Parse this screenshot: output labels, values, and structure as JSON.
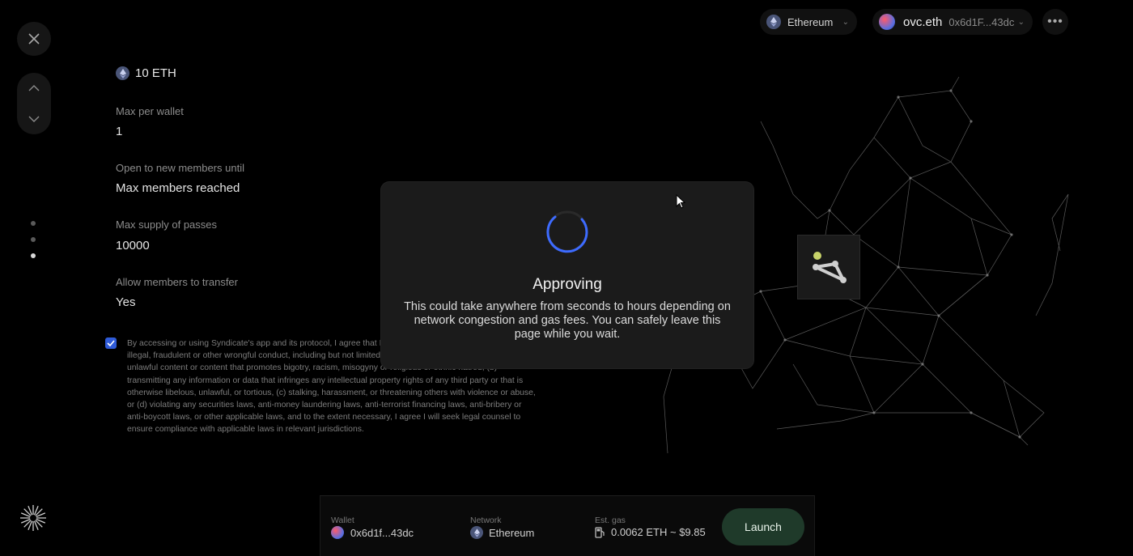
{
  "topbar": {
    "network_label": "Ethereum",
    "wallet_ens": "ovc.eth",
    "wallet_address": "0x6d1F...43dc",
    "more_icon": "more-horizontal-icon"
  },
  "rail": {
    "close_icon": "close-icon",
    "up_icon": "chevron-up-icon",
    "down_icon": "chevron-down-icon",
    "step_count": 3,
    "active_step": 3
  },
  "form": {
    "price": "10 ETH",
    "fields": [
      {
        "label": "Max per wallet",
        "value": "1"
      },
      {
        "label": "Open to new members until",
        "value": "Max members reached"
      },
      {
        "label": "Max supply of passes",
        "value": "10000"
      },
      {
        "label": "Allow members to transfer",
        "value": "Yes"
      }
    ],
    "terms_checked": true,
    "terms_text": "By accessing or using Syndicate's app and its protocol, I agree that I will not use the protocol to engage in illegal, fraudulent or other wrongful conduct, including but not limited to distributing defamatory, obscene or unlawful content or content that promotes bigotry, racism, misogyny or religious or ethnic hatred, (b) transmitting any information or data that infringes any intellectual property rights of any third party or that is otherwise libelous, unlawful, or tortious, (c) stalking, harassment, or threatening others with violence or abuse, or (d) violating any securities laws, anti-money laundering laws, anti-terrorist financing laws, anti-bribery or anti-boycott laws, or other applicable laws, and to the extent necessary, I agree I will seek legal counsel to ensure compliance with applicable laws in relevant jurisdictions."
  },
  "modal": {
    "title": "Approving",
    "body": "This could take anywhere from seconds to hours depending on network congestion and gas fees. You can safely leave this page while you wait."
  },
  "footer": {
    "wallet_label": "Wallet",
    "wallet_value": "0x6d1f...43dc",
    "network_label": "Network",
    "network_value": "Ethereum",
    "gas_label": "Est. gas",
    "gas_value": "0.0062 ETH ~ $9.85",
    "launch_label": "Launch"
  },
  "colors": {
    "accent_blue": "#3d6bff",
    "launch_bg": "#1f3a2a",
    "checkbox": "#2f5bd8"
  }
}
